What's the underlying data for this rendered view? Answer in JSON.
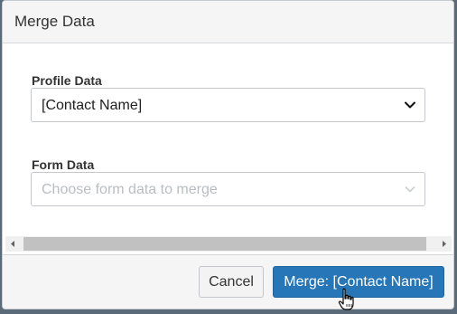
{
  "dialog": {
    "title": "Merge Data"
  },
  "profile_data": {
    "label": "Profile Data",
    "selected_value": "[Contact Name]"
  },
  "form_data": {
    "label": "Form Data",
    "placeholder": "Choose form data to merge"
  },
  "footer": {
    "cancel_label": "Cancel",
    "merge_label": "Merge: [Contact Name]"
  },
  "icons": {
    "profile_chevron": "chevron-down-icon",
    "form_chevron": "chevron-down-icon",
    "scroll_left": "arrow-left-icon",
    "scroll_right": "arrow-right-icon",
    "cursor": "hand-pointer-icon"
  },
  "colors": {
    "primary": "#2776b8",
    "header_bg": "#f5f5f5",
    "backdrop": "#5b6a78",
    "placeholder_text": "#b9bdc1"
  }
}
